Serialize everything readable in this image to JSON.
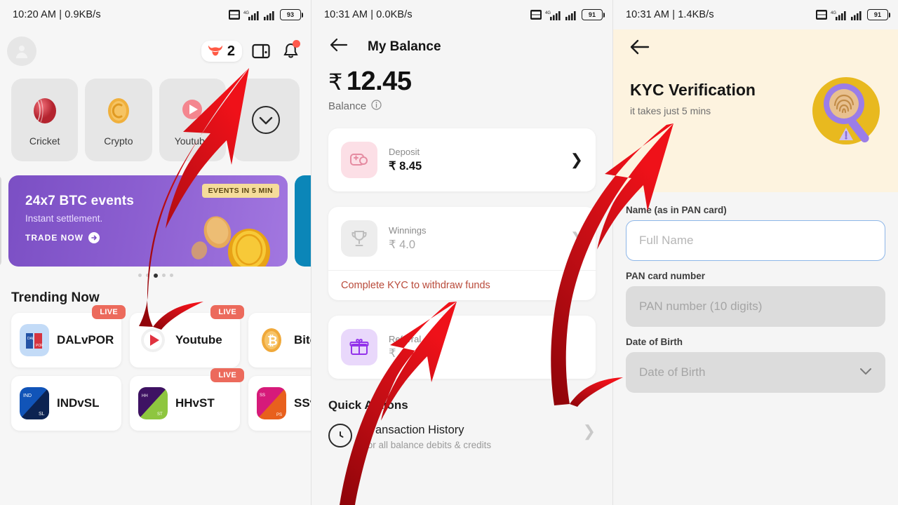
{
  "panels": {
    "home": {
      "statusbar": {
        "left": "10:20 AM | 0.9KB/s",
        "battery": "93",
        "network": "4G"
      },
      "header": {
        "bull_count": "2",
        "avatar_name": "profile-avatar",
        "wallet_name": "wallet-icon",
        "bell_name": "notification-bell"
      },
      "categories": [
        {
          "label": "Cricket",
          "icon": "cricket-ball"
        },
        {
          "label": "Crypto",
          "icon": "crypto-coin"
        },
        {
          "label": "Youtube",
          "icon": "youtube-play"
        },
        {
          "label": "",
          "icon": "chevron-down-circle"
        }
      ],
      "banner": {
        "title": "24x7 BTC events",
        "subtitle": "Instant settlement.",
        "cta": "TRADE NOW",
        "badge": "EVENTS IN 5 MIN"
      },
      "carousel_dots": 5,
      "carousel_active": 2,
      "trending_title": "Trending Now",
      "trending": [
        {
          "name": "DALvPOR",
          "live": true,
          "logo": "jersey"
        },
        {
          "name": "Youtube",
          "live": true,
          "logo": "play"
        },
        {
          "name": "Bitc",
          "live": false,
          "logo": "bitcoin"
        },
        {
          "name": "INDvSL",
          "live": false,
          "logo": "split-blue"
        },
        {
          "name": "HHvST",
          "live": true,
          "logo": "split-green"
        },
        {
          "name": "SSv",
          "live": false,
          "logo": "split-pink"
        }
      ],
      "live_label": "LIVE"
    },
    "balance": {
      "statusbar": {
        "left": "10:31 AM | 0.0KB/s",
        "battery": "91",
        "network": "4G"
      },
      "title": "My Balance",
      "amount": "12.45",
      "rupee": "₹",
      "amount_label": "Balance",
      "rows": [
        {
          "label": "Deposit",
          "value": "₹ 8.45",
          "icon": "wallet-plus-icon",
          "dim": false
        },
        {
          "label": "Winnings",
          "value": "₹ 4.0",
          "icon": "trophy-icon",
          "dim": true
        },
        {
          "label": "Referral",
          "value": "₹",
          "icon": "gift-icon",
          "dim": true
        }
      ],
      "kyc_note": "Complete KYC to withdraw funds",
      "quick_actions_title": "Quick Actions",
      "quick_actions": [
        {
          "title": "Transaction History",
          "subtitle": "for all balance debits & credits",
          "icon": "clock-icon"
        }
      ]
    },
    "kyc": {
      "statusbar": {
        "left": "10:31 AM | 1.4KB/s",
        "battery": "91",
        "network": "4G"
      },
      "title": "KYC Verification",
      "subtitle": "it takes just 5 mins",
      "illustration": "magnifier-fingerprint-icon",
      "fields": [
        {
          "label": "Name (as in PAN card)",
          "placeholder": "Full Name",
          "state": "active",
          "value": ""
        },
        {
          "label": "PAN card number",
          "placeholder": "PAN number (10 digits)",
          "state": "disabled",
          "value": ""
        },
        {
          "label": "Date of Birth",
          "placeholder": "Date of Birth",
          "state": "disabled",
          "value": "",
          "chevron": true
        }
      ]
    }
  },
  "annotations": {
    "arrow_color_light": "#E8111A",
    "arrow_color_dark": "#A00A10",
    "arrows": [
      {
        "name": "arrow-to-wallet-icon"
      },
      {
        "name": "arrow-to-complete-kyc-link"
      },
      {
        "name": "arrow-to-kyc-verification"
      }
    ]
  }
}
